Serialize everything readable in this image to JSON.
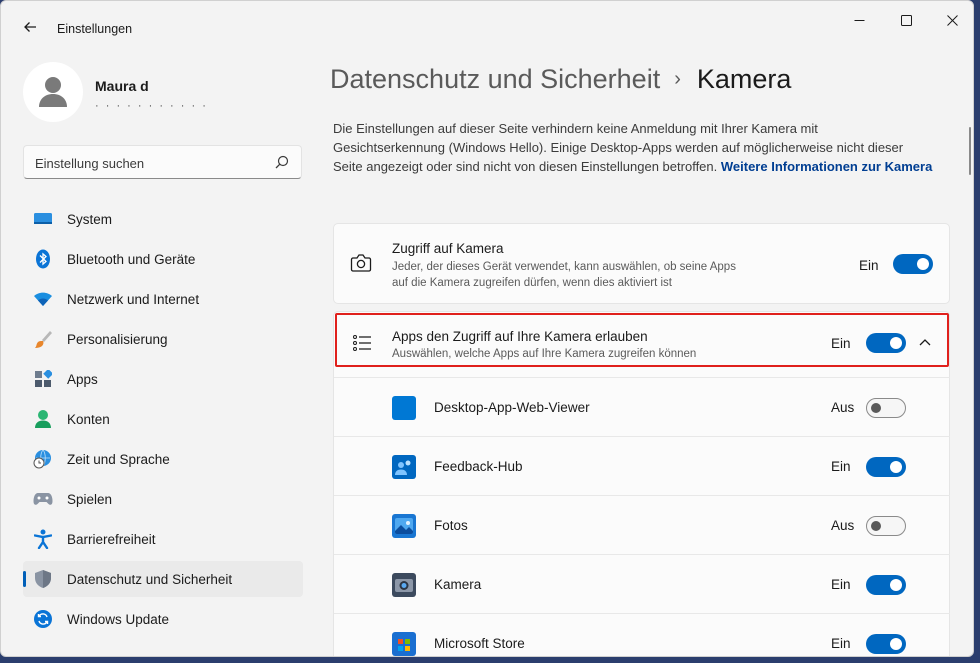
{
  "window": {
    "title": "Einstellungen",
    "back_icon": "arrow-left-icon",
    "controls": [
      "minimize-icon",
      "maximize-icon",
      "close-icon"
    ]
  },
  "profile": {
    "name": "Maura d",
    "sub": "· · · · · · · · · · ·"
  },
  "search": {
    "placeholder": "Einstellung suchen",
    "icon": "search-icon"
  },
  "nav": {
    "items": [
      {
        "label": "System",
        "icon": "system-display-icon"
      },
      {
        "label": "Bluetooth und Geräte",
        "icon": "bluetooth-icon"
      },
      {
        "label": "Netzwerk und Internet",
        "icon": "wifi-icon"
      },
      {
        "label": "Personalisierung",
        "icon": "brush-icon"
      },
      {
        "label": "Apps",
        "icon": "apps-icon"
      },
      {
        "label": "Konten",
        "icon": "person-icon"
      },
      {
        "label": "Zeit und Sprache",
        "icon": "globe-clock-icon"
      },
      {
        "label": "Spielen",
        "icon": "gamepad-icon"
      },
      {
        "label": "Barrierefreiheit",
        "icon": "accessibility-icon"
      },
      {
        "label": "Datenschutz und Sicherheit",
        "icon": "shield-icon",
        "selected": true
      },
      {
        "label": "Windows Update",
        "icon": "update-icon"
      }
    ]
  },
  "breadcrumb": {
    "parent": "Datenschutz und Sicherheit",
    "separator": "›",
    "current": "Kamera"
  },
  "description": {
    "text": "Die Einstellungen auf dieser Seite verhindern keine Anmeldung mit Ihrer Kamera mit Gesichtserkennung (Windows Hello). Einige Desktop-Apps werden auf möglicherweise nicht dieser Seite angezeigt oder sind nicht von diesen Einstellungen betroffen.",
    "link": "Weitere Informationen zur Kamera"
  },
  "camera_access": {
    "title": "Zugriff auf Kamera",
    "subtitle_line1": "Jeder, der dieses Gerät verwendet, kann auswählen, ob seine Apps",
    "subtitle_line2": "auf die Kamera zugreifen dürfen, wenn dies aktiviert ist",
    "state": "Ein",
    "on": true,
    "icon": "camera-icon"
  },
  "app_access": {
    "title": "Apps den Zugriff auf Ihre Kamera erlauben",
    "subtitle": "Auswählen, welche Apps auf Ihre Kamera zugreifen können",
    "state": "Ein",
    "on": true,
    "icon": "list-icon",
    "expand_icon": "chevron-up-icon"
  },
  "apps": [
    {
      "name": "Desktop-App-Web-Viewer",
      "state": "Aus",
      "on": false,
      "icon": "web-viewer-icon",
      "color": "#0078d4"
    },
    {
      "name": "Feedback-Hub",
      "state": "Ein",
      "on": true,
      "icon": "feedback-hub-icon",
      "color": "#0067c0"
    },
    {
      "name": "Fotos",
      "state": "Aus",
      "on": false,
      "icon": "photos-icon",
      "color": "#1976d2"
    },
    {
      "name": "Kamera",
      "state": "Ein",
      "on": true,
      "icon": "camera-app-icon",
      "color": "#3c4a5e"
    },
    {
      "name": "Microsoft Store",
      "state": "Ein",
      "on": true,
      "icon": "store-icon",
      "color": "#1a6fd1"
    }
  ],
  "colors": {
    "accent": "#0067c0",
    "highlight_border": "#e0201c",
    "link": "#003e92"
  }
}
